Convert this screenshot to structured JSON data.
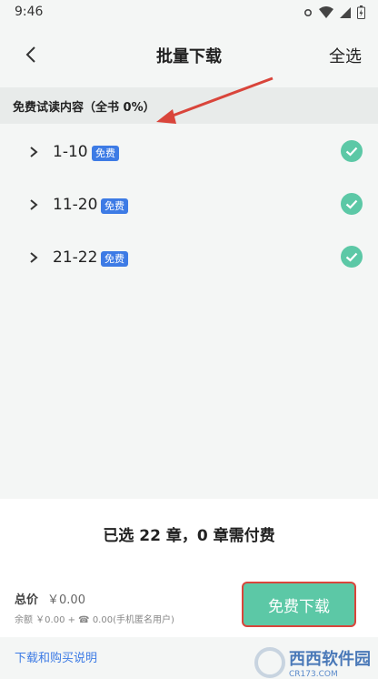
{
  "status": {
    "time": "9:46"
  },
  "header": {
    "title": "批量下载",
    "select_all": "全选"
  },
  "section": {
    "title": "免费试读内容（全书 0%）"
  },
  "chapters": [
    {
      "range": "1-10",
      "badge": "免费",
      "checked": true
    },
    {
      "range": "11-20",
      "badge": "免费",
      "checked": true
    },
    {
      "range": "21-22",
      "badge": "免费",
      "checked": true
    }
  ],
  "bottom": {
    "summary": "已选 22 章，0 章需付费",
    "total_label": "总价",
    "total_value": "￥0.00",
    "balance": "余额 ￥0.00 + ☎ 0.00(手机匿名用户)",
    "download_button": "免费下载",
    "footer_link": "下载和购买说明"
  },
  "watermark": {
    "brand": "西西软件园",
    "sub": "CR173.COM"
  },
  "colors": {
    "accent": "#5cc8a6",
    "badge": "#3d7be5",
    "annotation": "#d9453b"
  }
}
